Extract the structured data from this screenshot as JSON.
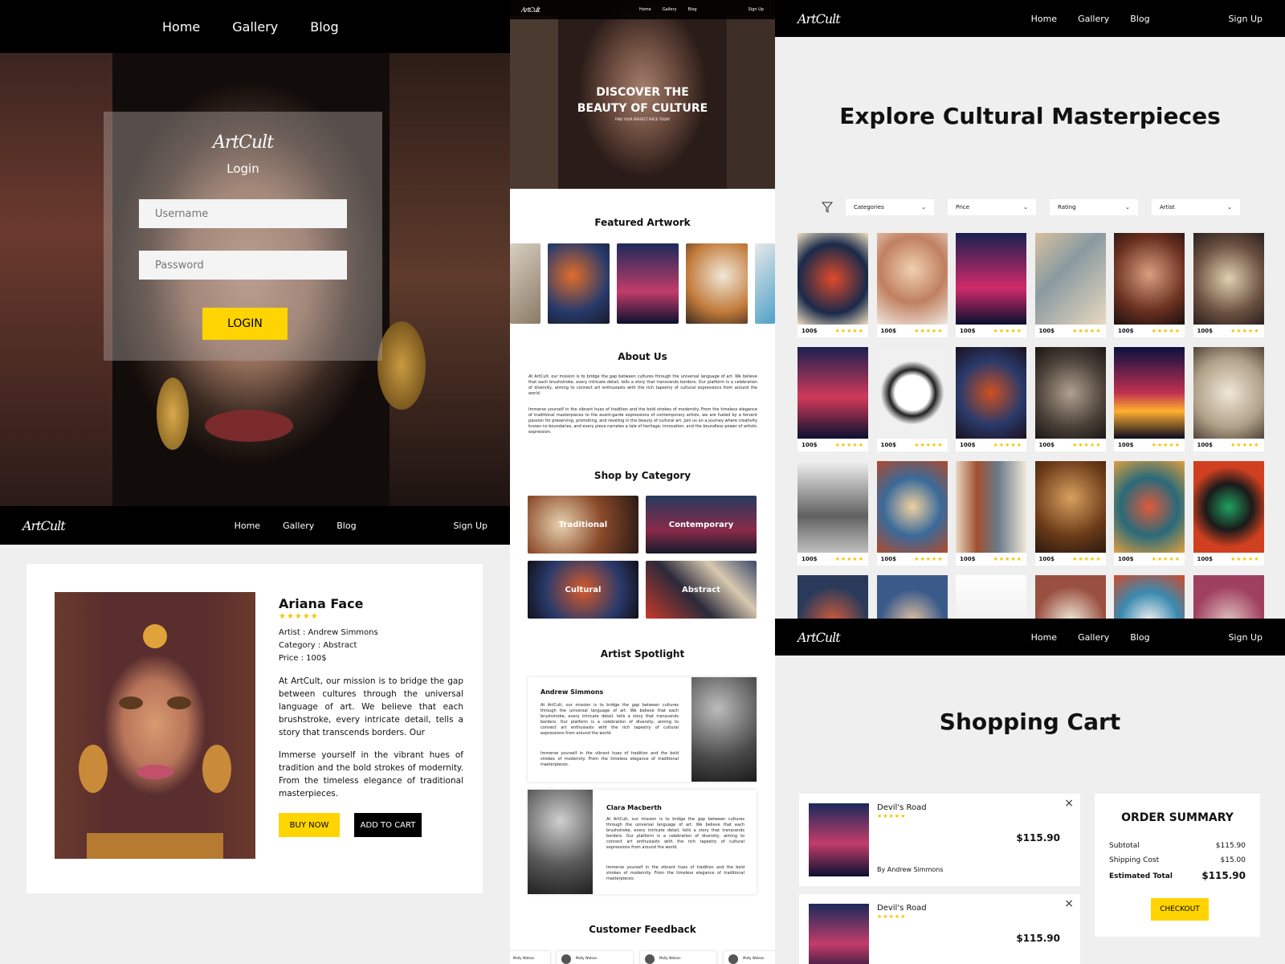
{
  "login_panel": {
    "nav": [
      "Home",
      "Gallery",
      "Blog"
    ],
    "logo": "ArtCult",
    "title": "Login",
    "username_placeholder": "Username",
    "password_placeholder": "Password",
    "login_button": "LOGIN"
  },
  "home_panel": {
    "logo": "ArtCult",
    "nav": [
      "Home",
      "Gallery",
      "Blog"
    ],
    "signup": "Sign Up",
    "hero_title_1": "DISCOVER THE",
    "hero_title_2": "BEAUTY OF CULTURE",
    "hero_sub": "FIND YOUR PERFECT PIECE TODAY",
    "featured_title": "Featured Artwork",
    "about_title": "About Us",
    "about_p1": "At ArtCult, our mission is to bridge the gap between cultures through the universal language of art. We believe that each brushstroke, every intricate detail, tells a story that transcends borders. Our platform is a celebration of diversity, aiming to connect art enthusiasts with the rich tapestry of cultural expressions from around the world.",
    "about_p2": "Immerse yourself in the vibrant hues of tradition and the bold strokes of modernity. From the timeless elegance of traditional masterpieces to the avant-garde expressions of contemporary artists, we are fueled by a fervent passion for preserving, promoting, and reveling in the beauty of cultural art. Join us on a journey where creativity knows no boundaries, and every piece narrates a tale of heritage, innovation, and the boundless power of artistic expression.",
    "shop_title": "Shop by Category",
    "categories": [
      "Traditional",
      "Contemporary",
      "Cultural",
      "Abstract"
    ],
    "spotlight_title": "Artist Spotlight",
    "artists": [
      {
        "name": "Andrew Simmons",
        "p1": "At ArtCult, our mission is to bridge the gap between cultures through the universal language of art. We believe that each brushstroke, every intricate detail, tells a story that transcends borders. Our platform is a celebration of diversity, aiming to connect art enthusiasts with the rich tapestry of cultural expressions from around the world.",
        "p2": "Immerse yourself in the vibrant hues of tradition and the bold strokes of modernity. From the timeless elegance of traditional masterpieces."
      },
      {
        "name": "Clara Macberth",
        "p1": "At ArtCult, our mission is to bridge the gap between cultures through the universal language of art. We believe that each brushstroke, every intricate detail, tells a story that transcends borders. Our platform is a celebration of diversity, aiming to connect art enthusiasts with the rich tapestry of cultural expressions from around the world.",
        "p2": "Immerse yourself in the vibrant hues of tradition and the bold strokes of modernity. From the timeless elegance of traditional masterpieces."
      }
    ],
    "feedback_title": "Customer Feedback",
    "feedback_names": [
      "Molly Watson",
      "Molly Watson",
      "Molly Watson",
      "Molly Watson"
    ]
  },
  "product_panel": {
    "logo": "ArtCult",
    "nav": [
      "Home",
      "Gallery",
      "Blog"
    ],
    "signup": "Sign Up",
    "name": "Ariana Face",
    "stars": "★★★★★",
    "artist": "Artist : Andrew Simmons",
    "category": "Category : Abstract",
    "price": "Price : 100$",
    "desc1": "At ArtCult, our mission is to bridge the gap between cultures through the universal language of art. We believe that each brushstroke, every intricate detail, tells a story that transcends borders. Our",
    "desc2": "Immerse yourself in the vibrant hues of tradition and the bold strokes of modernity. From the timeless elegance of traditional masterpieces.",
    "buy_now": "BUY NOW",
    "add_to_cart": "ADD TO CART"
  },
  "gallery_panel": {
    "logo": "ArtCult",
    "nav": [
      "Home",
      "Gallery",
      "Blog"
    ],
    "signup": "Sign Up",
    "title": "Explore Cultural Masterpieces",
    "filters": [
      "Categories",
      "Price",
      "Rating",
      "Artist"
    ],
    "item_price": "100$",
    "item_stars": "★★★★★"
  },
  "cart_panel": {
    "logo": "ArtCult",
    "nav": [
      "Home",
      "Gallery",
      "Blog"
    ],
    "signup": "Sign Up",
    "title": "Shopping Cart",
    "items": [
      {
        "name": "Devil's Road",
        "stars": "★★★★★",
        "price": "$115.90",
        "by": "By Andrew Simmons"
      },
      {
        "name": "Devil's Road",
        "stars": "★★★★★",
        "price": "$115.90"
      }
    ],
    "summary_title": "ORDER SUMMARY",
    "subtotal_label": "Subtotal",
    "subtotal": "$115.90",
    "shipping_label": "Shipping Cost",
    "shipping": "$15.00",
    "total_label": "Estimated Total",
    "total": "$115.90",
    "checkout": "CHECKOUT"
  }
}
